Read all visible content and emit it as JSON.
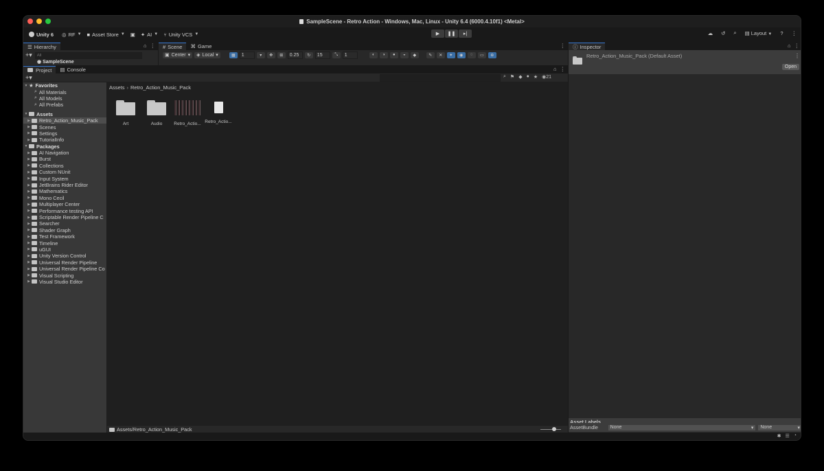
{
  "window": {
    "title": "SampleScene - Retro Action - Windows, Mac, Linux - Unity 6.4 (6000.4.10f1) <Metal>"
  },
  "toolbar": {
    "account": "Unity 6",
    "user": "RF",
    "asset_store": "Asset Store",
    "ai": "AI",
    "vcs": "Unity VCS",
    "layout": "Layout"
  },
  "hierarchy": {
    "tab": "Hierarchy",
    "search_placeholder": "All",
    "scene": "SampleScene"
  },
  "scene_view": {
    "tabs": [
      "Scene",
      "Game"
    ],
    "pivot": "Center",
    "space": "Local",
    "grid_value": "1",
    "snap_value": "0.25",
    "rotate_value": "15",
    "scale_value": "1"
  },
  "project": {
    "tabs": [
      "Project",
      "Console"
    ],
    "hidden_count": "21",
    "favorites": {
      "label": "Favorites",
      "items": [
        "All Materials",
        "All Models",
        "All Prefabs"
      ]
    },
    "assets": {
      "label": "Assets",
      "items": [
        "Retro_Action_Music_Pack",
        "Scenes",
        "Settings",
        "TutorialInfo"
      ]
    },
    "packages": {
      "label": "Packages",
      "items": [
        "AI Navigation",
        "Burst",
        "Collections",
        "Custom NUnit",
        "Input System",
        "JetBrains Rider Editor",
        "Mathematics",
        "Mono Cecil",
        "Multiplayer Center",
        "Performance testing API",
        "Scriptable Render Pipeline C",
        "Searcher",
        "Shader Graph",
        "Test Framework",
        "Timeline",
        "uGUI",
        "Unity Version Control",
        "Universal Render Pipeline",
        "Universal Render Pipeline Co",
        "Visual Scripting",
        "Visual Studio Editor"
      ]
    },
    "breadcrumb": [
      "Assets",
      "Retro_Action_Music_Pack"
    ],
    "grid_items": [
      "Art",
      "Audio",
      "Retro_Actio...",
      "Retro_Actio..."
    ],
    "status_path": "Assets/Retro_Action_Music_Pack"
  },
  "inspector": {
    "tab": "Inspector",
    "asset_title": "Retro_Action_Music_Pack (Default Asset)",
    "open_label": "Open",
    "asset_labels": "Asset Labels",
    "asset_bundle_label": "AssetBundle",
    "bundle_value": "None",
    "variant_value": "None"
  },
  "colors": {
    "window_bg": "#191919",
    "panel_bg": "#282828",
    "tree_bg": "#383838",
    "accent": "#3a7bd5"
  }
}
